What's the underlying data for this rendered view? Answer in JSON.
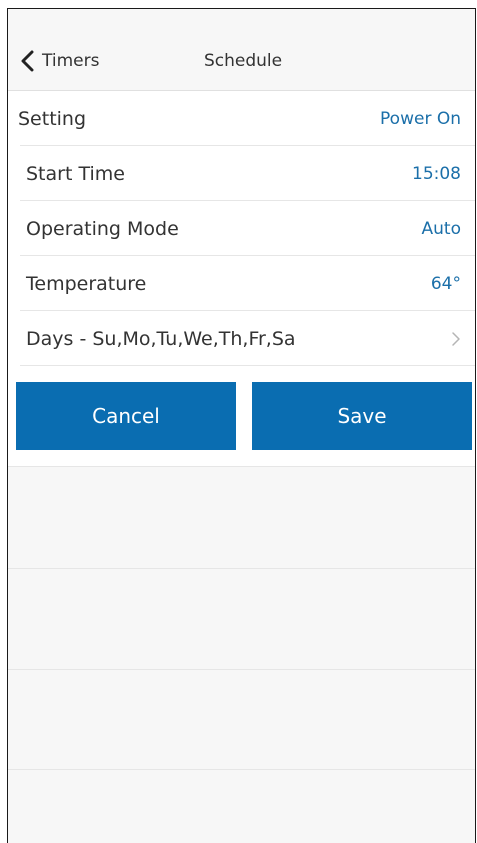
{
  "navbar": {
    "back_label": "Timers",
    "title": "Schedule"
  },
  "rows": [
    {
      "label": "Setting",
      "value": "Power On"
    },
    {
      "label": "Start Time",
      "value": "15:08"
    },
    {
      "label": "Operating Mode",
      "value": "Auto"
    },
    {
      "label": "Temperature",
      "value": "64°"
    },
    {
      "label": "Days - Su,Mo,Tu,We,Th,Fr,Sa",
      "value": ""
    }
  ],
  "buttons": {
    "cancel": "Cancel",
    "save": "Save"
  },
  "colors": {
    "accent": "#0a6db1",
    "value_text": "#1b6fa9"
  }
}
